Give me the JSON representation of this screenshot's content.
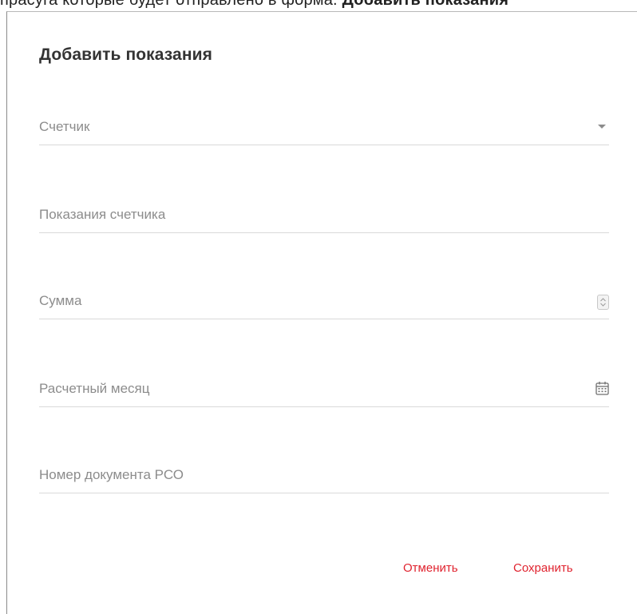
{
  "background": {
    "caption_text": "прасуга которые будет отправлено в форма. ",
    "caption_bold": "Добавить показания"
  },
  "dialog": {
    "title": "Добавить показания",
    "fields": [
      {
        "label": "Счетчик",
        "icon": "chevron-down-icon"
      },
      {
        "label": "Показания счетчика",
        "icon": ""
      },
      {
        "label": "Сумма",
        "icon": "number-stepper-icon"
      },
      {
        "label": "Расчетный месяц",
        "icon": "calendar-icon"
      },
      {
        "label": "Номер документа РСО",
        "icon": ""
      }
    ],
    "buttons": {
      "cancel": "Отменить",
      "save": "Сохранить"
    }
  },
  "colors": {
    "accent": "#e0232f",
    "label": "#8c8c8c",
    "divider": "#d9d9d9",
    "title": "#333333"
  }
}
